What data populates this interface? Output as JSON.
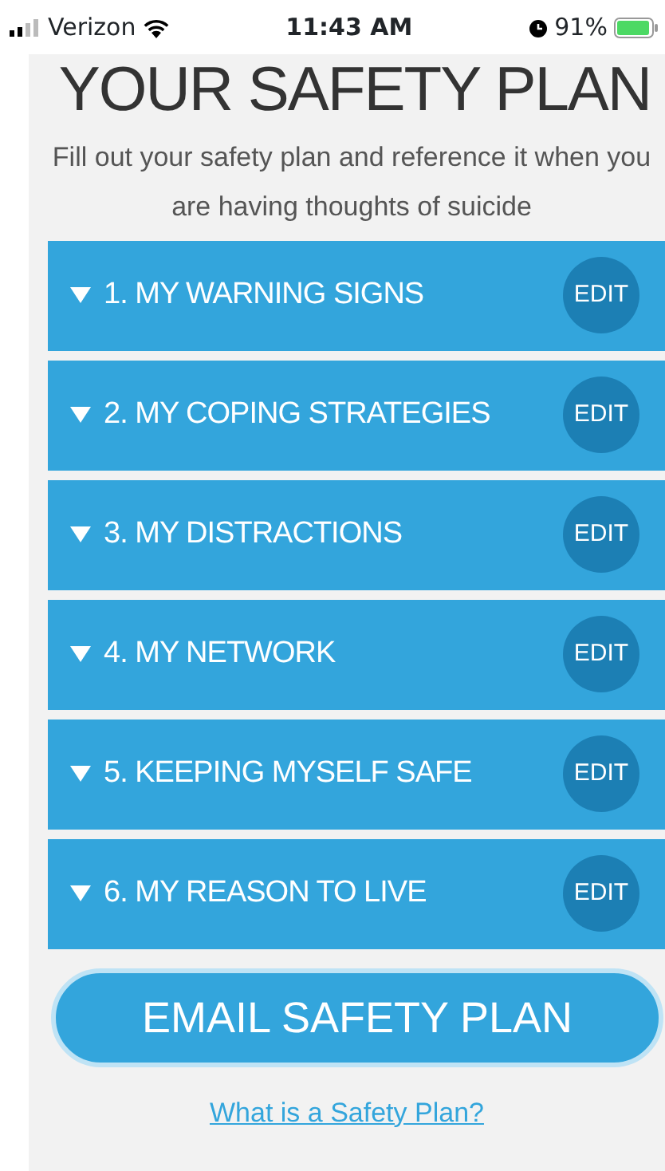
{
  "status_bar": {
    "carrier": "Verizon",
    "time": "11:43 AM",
    "battery": "91%"
  },
  "title": "YOUR SAFETY PLAN",
  "subtitle": "Fill out your safety plan and reference it when you are having thoughts of suicide",
  "sections": [
    {
      "label": "1. MY WARNING SIGNS",
      "action": "EDIT"
    },
    {
      "label": "2. MY COPING STRATEGIES",
      "action": "EDIT"
    },
    {
      "label": "3. MY DISTRACTIONS",
      "action": "EDIT"
    },
    {
      "label": "4. MY NETWORK",
      "action": "EDIT"
    },
    {
      "label": "5. KEEPING MYSELF SAFE",
      "action": "EDIT"
    },
    {
      "label": "6. MY REASON TO LIVE",
      "action": "EDIT"
    }
  ],
  "email_button": "EMAIL SAFETY PLAN",
  "help_link": "What is a Safety Plan?"
}
